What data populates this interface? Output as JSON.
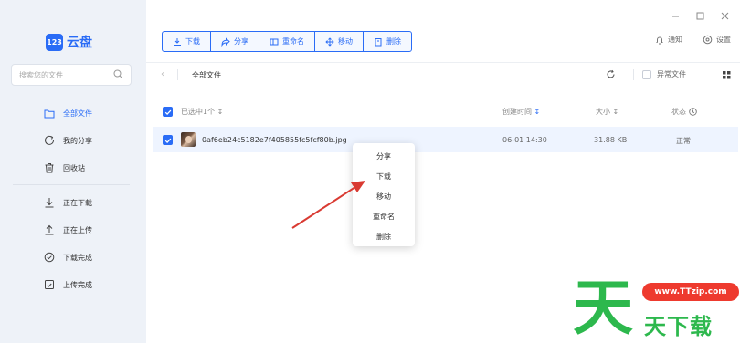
{
  "app": {
    "logo_badge": "123",
    "logo_text": "云盘"
  },
  "sidebar": {
    "search_placeholder": "搜索您的文件",
    "items": [
      {
        "label": "全部文件",
        "icon": "folder-icon",
        "active": true
      },
      {
        "label": "我的分享",
        "icon": "share-icon"
      },
      {
        "label": "回收站",
        "icon": "trash-icon"
      },
      {
        "label": "正在下载",
        "icon": "download-icon"
      },
      {
        "label": "正在上传",
        "icon": "upload-icon"
      },
      {
        "label": "下载完成",
        "icon": "check-circle-icon"
      },
      {
        "label": "上传完成",
        "icon": "upload-done-icon"
      }
    ]
  },
  "toolbar": {
    "download": "下载",
    "share": "分享",
    "rename": "重命名",
    "move": "移动",
    "delete": "删除"
  },
  "topright": {
    "notify": "通知",
    "settings": "设置"
  },
  "pathbar": {
    "crumb": "全部文件",
    "abnormal": "异常文件"
  },
  "table": {
    "selected": "已选中1个",
    "col_date": "创建时间",
    "col_size": "大小",
    "col_state": "状态",
    "rows": [
      {
        "name": "0af6eb24c5182e7f405855fc5fcf80b.jpg",
        "date": "06-01 14:30",
        "size": "31.88 KB",
        "state": "正常"
      }
    ]
  },
  "context_menu": [
    "分享",
    "下载",
    "移动",
    "重命名",
    "删除"
  ],
  "watermark": {
    "big": "天",
    "url": "www.TTzip.com",
    "sub": "天下载"
  },
  "colors": {
    "accent": "#2a6cf6",
    "arrow": "#d93a32",
    "watermark_green": "#2db84d",
    "watermark_red": "#ee3a2e"
  }
}
